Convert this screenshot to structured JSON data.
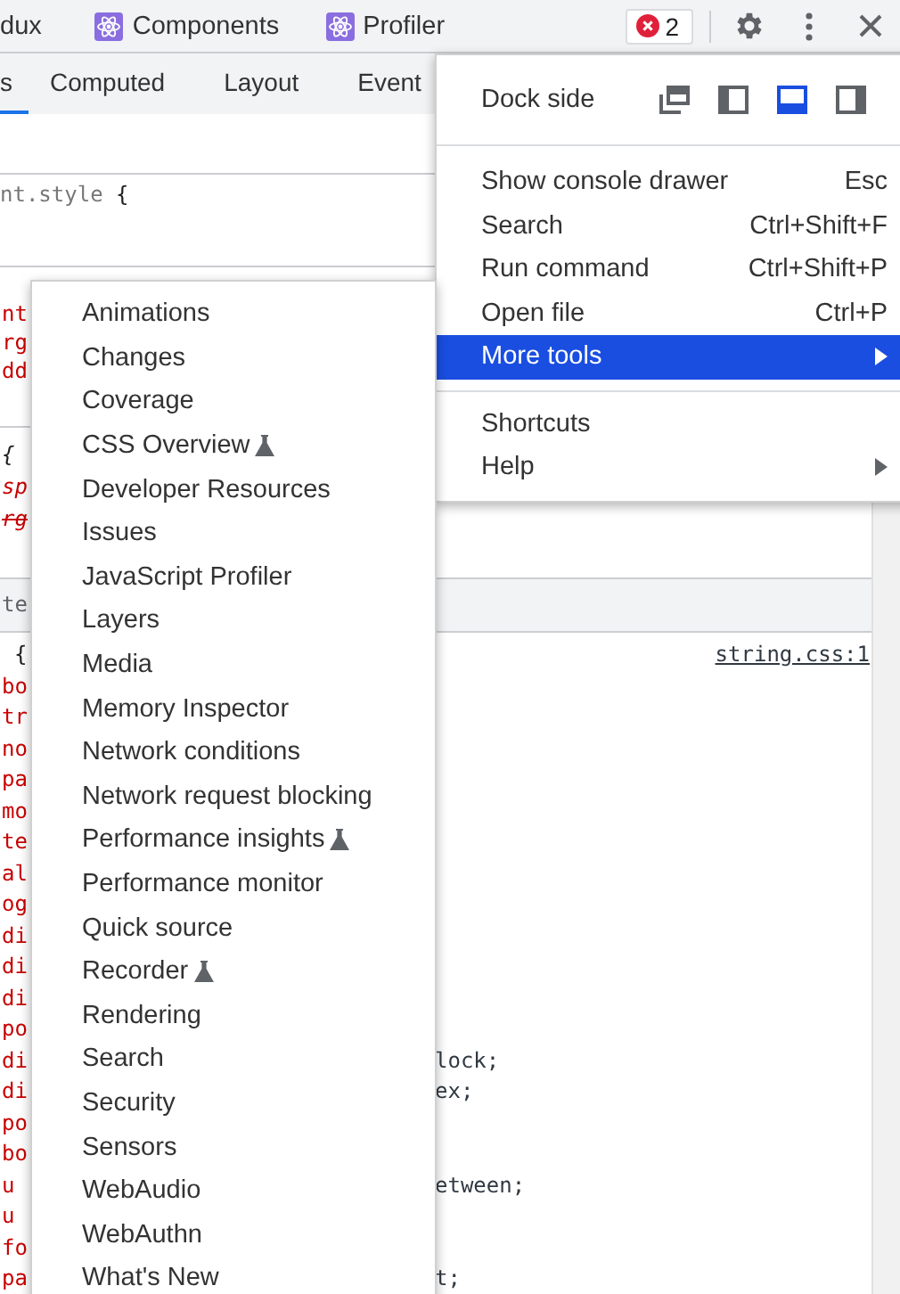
{
  "toolbar": {
    "tabs": [
      {
        "label": "dux",
        "has_icon": false
      },
      {
        "label": "Components",
        "has_icon": true
      },
      {
        "label": "Profiler",
        "has_icon": true
      }
    ],
    "error_count": "2"
  },
  "subtabs": [
    {
      "label": "s",
      "selected": true
    },
    {
      "label": "Computed",
      "selected": false
    },
    {
      "label": "Layout",
      "selected": false
    },
    {
      "label": "Event",
      "selected": false
    }
  ],
  "styles": {
    "element_style": {
      "selector": "nt.style",
      "brace": "{"
    },
    "blocks": [
      {
        "lines": [
          {
            "text": "nt",
            "kind": "prop"
          },
          {
            "text": "rg",
            "kind": "prop"
          },
          {
            "text": "dd",
            "kind": "prop"
          }
        ]
      },
      {
        "lines": [
          {
            "text": "{",
            "kind": "brace"
          },
          {
            "text": "sp",
            "kind": "inherited"
          },
          {
            "text": "rg",
            "kind": "overridden"
          }
        ]
      }
    ],
    "section_header": "te",
    "rule": {
      "brace": "{",
      "source": "string.css:1",
      "lines": [
        {
          "text": "bo",
          "kind": "prop"
        },
        {
          "text": "tr",
          "kind": "prop"
        },
        {
          "text": "no",
          "kind": "prop"
        },
        {
          "text": "pa",
          "kind": "prop"
        },
        {
          "text": "mo",
          "kind": "prop"
        },
        {
          "text": "te",
          "kind": "prop"
        },
        {
          "text": "al",
          "kind": "prop"
        },
        {
          "text": "og",
          "kind": "prop"
        },
        {
          "text": "di",
          "kind": "prop"
        },
        {
          "text": "di",
          "kind": "prop"
        },
        {
          "text": "di",
          "kind": "prop"
        },
        {
          "text": "po",
          "kind": "prop"
        },
        {
          "text": "di",
          "kind": "prop",
          "tail": "lock;"
        },
        {
          "text": "di",
          "kind": "prop",
          "tail": "ex;"
        },
        {
          "text": "po",
          "kind": "prop"
        },
        {
          "text": "bo",
          "kind": "prop"
        },
        {
          "text": "u",
          "kind": "prop",
          "tail": "etween;"
        },
        {
          "text": "u",
          "kind": "prop"
        },
        {
          "text": "fo",
          "kind": "prop"
        },
        {
          "text": "pa",
          "kind": "prop",
          "tail": "t;"
        }
      ]
    }
  },
  "main_menu": {
    "dock_label": "Dock side",
    "dock_options": [
      {
        "kind": "undock",
        "selected": false
      },
      {
        "kind": "left",
        "selected": false
      },
      {
        "kind": "bottom",
        "selected": true
      },
      {
        "kind": "right",
        "selected": false
      }
    ],
    "groups": [
      [
        {
          "label": "Show console drawer",
          "shortcut": "Esc",
          "has_submenu": false,
          "selected": false
        },
        {
          "label": "Search",
          "shortcut": "Ctrl+Shift+F",
          "has_submenu": false,
          "selected": false
        },
        {
          "label": "Run command",
          "shortcut": "Ctrl+Shift+P",
          "has_submenu": false,
          "selected": false
        },
        {
          "label": "Open file",
          "shortcut": "Ctrl+P",
          "has_submenu": false,
          "selected": false
        },
        {
          "label": "More tools",
          "has_submenu": true,
          "selected": true
        }
      ],
      [
        {
          "label": "Shortcuts",
          "has_submenu": false,
          "selected": false
        },
        {
          "label": "Help",
          "has_submenu": true,
          "selected": false
        }
      ]
    ]
  },
  "more_tools_menu": [
    {
      "label": "Animations",
      "experimental": false
    },
    {
      "label": "Changes",
      "experimental": false
    },
    {
      "label": "Coverage",
      "experimental": false
    },
    {
      "label": "CSS Overview",
      "experimental": true
    },
    {
      "label": "Developer Resources",
      "experimental": false
    },
    {
      "label": "Issues",
      "experimental": false
    },
    {
      "label": "JavaScript Profiler",
      "experimental": false
    },
    {
      "label": "Layers",
      "experimental": false
    },
    {
      "label": "Media",
      "experimental": false
    },
    {
      "label": "Memory Inspector",
      "experimental": false
    },
    {
      "label": "Network conditions",
      "experimental": false
    },
    {
      "label": "Network request blocking",
      "experimental": false
    },
    {
      "label": "Performance insights",
      "experimental": true
    },
    {
      "label": "Performance monitor",
      "experimental": false
    },
    {
      "label": "Quick source",
      "experimental": false
    },
    {
      "label": "Recorder",
      "experimental": true
    },
    {
      "label": "Rendering",
      "experimental": false
    },
    {
      "label": "Search",
      "experimental": false
    },
    {
      "label": "Security",
      "experimental": false
    },
    {
      "label": "Sensors",
      "experimental": false
    },
    {
      "label": "WebAudio",
      "experimental": false
    },
    {
      "label": "WebAuthn",
      "experimental": false
    },
    {
      "label": "What's New",
      "experimental": false
    }
  ]
}
